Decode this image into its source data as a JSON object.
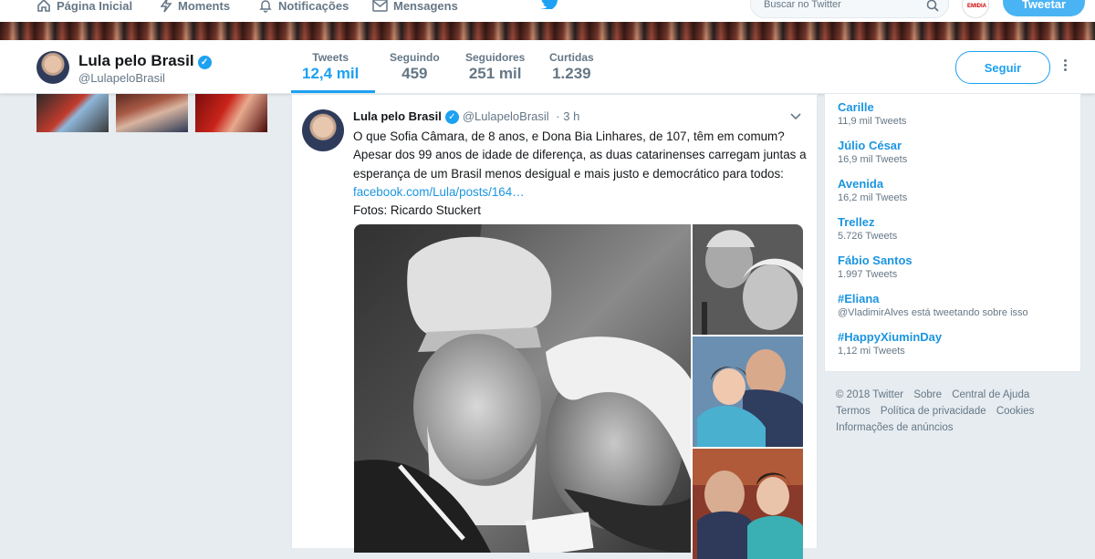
{
  "nav": {
    "home": "Página Inicial",
    "moments": "Moments",
    "notifications": "Notificações",
    "messages": "Mensagens",
    "search_placeholder": "Buscar no Twitter",
    "tweet_button": "Tweetar"
  },
  "profile": {
    "name": "Lula pelo Brasil",
    "handle": "@LulapeloBrasil",
    "follow_button": "Seguir",
    "stats": [
      {
        "label": "Tweets",
        "value": "12,4 mil"
      },
      {
        "label": "Seguindo",
        "value": "459"
      },
      {
        "label": "Seguidores",
        "value": "251 mil"
      },
      {
        "label": "Curtidas",
        "value": "1.239"
      }
    ]
  },
  "tweet": {
    "name": "Lula pelo Brasil",
    "handle": "@LulapeloBrasil",
    "time": "· 3 h",
    "lines": [
      "O que Sofia Câmara, de 8 anos, e Dona Bia Linhares, de 107, têm em comum?",
      "Apesar dos 99 anos de idade de diferença, as duas catarinenses carregam juntas a",
      "esperança de um Brasil menos desigual e mais justo e democrático para todos:"
    ],
    "link": "facebook.com/Lula/posts/164…",
    "credit": "Fotos: Ricardo Stuckert"
  },
  "trends": [
    {
      "name": "Carille",
      "count": "11,9 mil Tweets"
    },
    {
      "name": "Júlio César",
      "count": "16,9 mil Tweets"
    },
    {
      "name": "Avenida",
      "count": "16,2 mil Tweets"
    },
    {
      "name": "Trellez",
      "count": "5.726 Tweets"
    },
    {
      "name": "Fábio Santos",
      "count": "1.997 Tweets"
    },
    {
      "name": "#Eliana",
      "count": "@VladimirAlves está tweetando sobre isso"
    },
    {
      "name": "#HappyXiuminDay",
      "count": "1,12 mi Tweets"
    }
  ],
  "footer": {
    "copyright": "© 2018 Twitter",
    "about": "Sobre",
    "help": "Central de Ajuda",
    "terms": "Termos",
    "privacy": "Política de privacidade",
    "cookies": "Cookies",
    "ads": "Informações de anúncios"
  },
  "colors": {
    "accent": "#1da1f2",
    "link": "#1b95e0",
    "muted": "#657786",
    "background": "#e6ecf0"
  },
  "avatar_badge": "EMIDIA"
}
